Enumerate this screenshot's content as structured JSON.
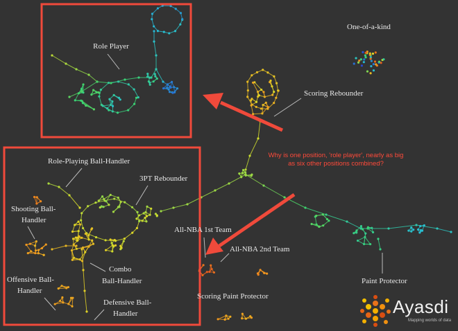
{
  "colors": {
    "background": "#333333",
    "highlight_box": "#f04a3b",
    "arrow": "#f04a3b",
    "label_text": "#e8e8e8",
    "question_text": "#ff4a3a"
  },
  "labels": {
    "role_player": "Role Player",
    "one_of_a_kind": "One-of-a-kind",
    "scoring_rebounder": "Scoring Rebounder",
    "role_playing_ball_handler": "Role-Playing Ball-Handler",
    "three_pt_rebounder": "3PT Rebounder",
    "shooting_ball_handler_1": "Shooting Ball-",
    "shooting_ball_handler_2": "Handler",
    "all_nba_1st": "All-NBA 1st Team",
    "all_nba_2nd": "All-NBA 2nd Team",
    "combo_1": "Combo",
    "combo_2": "Ball-Handler",
    "offensive_1": "Offensive Ball-",
    "offensive_2": "Handler",
    "defensive_1": "Defensive Ball-",
    "defensive_2": "Handler",
    "paint_protector": "Paint Protector",
    "scoring_paint_protector": "Scoring Paint Protector"
  },
  "annotation": {
    "question": "Why is one position, 'role player', nearly as big as six other positions combined?"
  },
  "logo": {
    "name": "Ayasdi",
    "tagline": "Mapping worlds of data",
    "icon": "ayasdi-logo-icon"
  }
}
